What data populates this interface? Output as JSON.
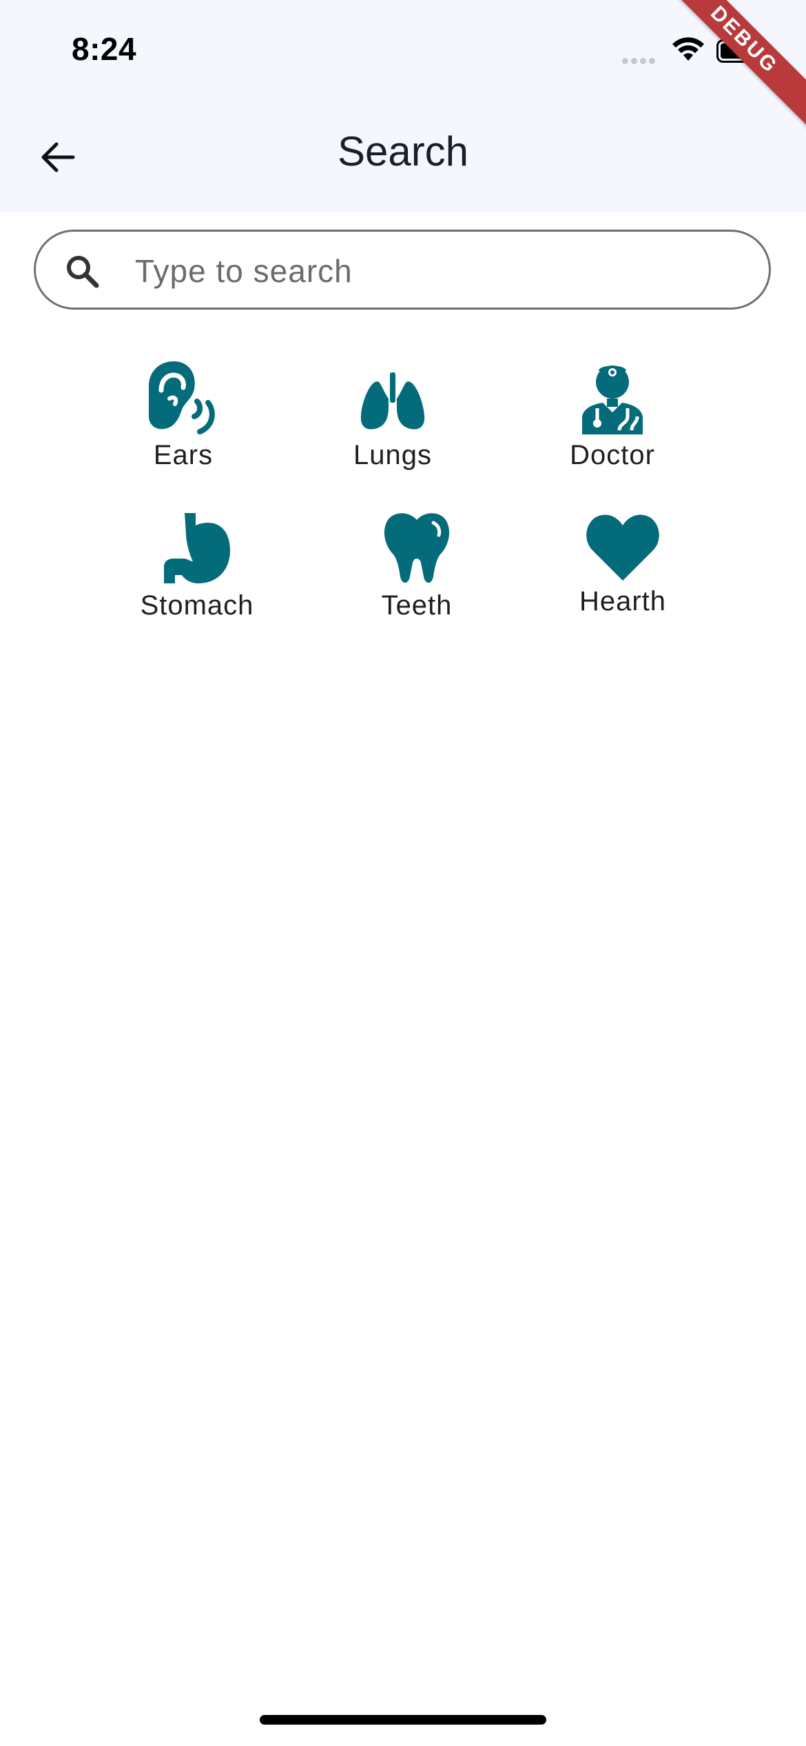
{
  "status_bar": {
    "time": "8:24"
  },
  "debug_banner": "DEBUG",
  "header": {
    "title": "Search"
  },
  "search": {
    "placeholder": "Type to search",
    "value": ""
  },
  "categories": [
    {
      "label": "Ears",
      "icon": "ear-icon"
    },
    {
      "label": "Lungs",
      "icon": "lungs-icon"
    },
    {
      "label": "Doctor",
      "icon": "doctor-icon"
    },
    {
      "label": "Stomach",
      "icon": "stomach-icon"
    },
    {
      "label": "Teeth",
      "icon": "tooth-icon"
    },
    {
      "label": "Hearth",
      "icon": "heart-icon"
    }
  ],
  "colors": {
    "accent": "#046b7a",
    "header_bg": "#f4f7fd",
    "debug_banner": "#b83a3a"
  }
}
